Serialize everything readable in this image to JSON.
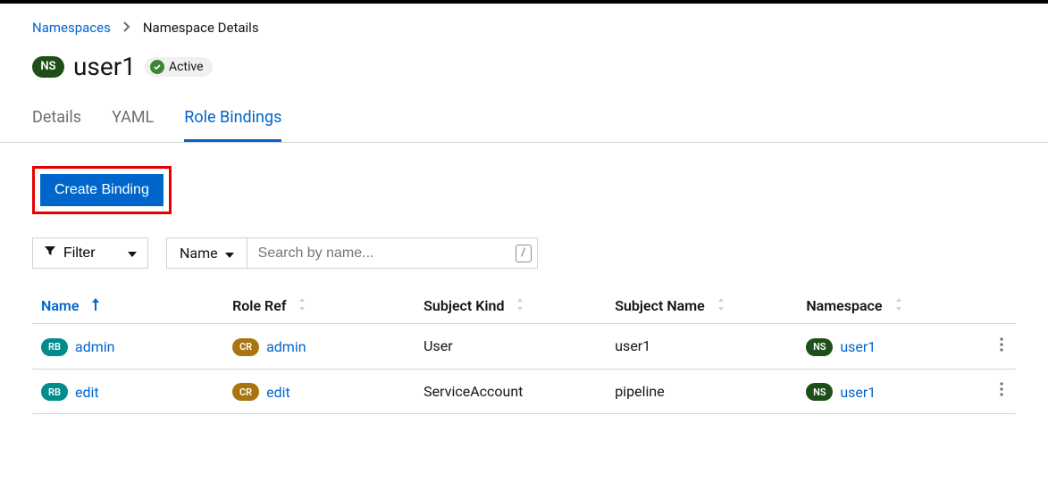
{
  "breadcrumb": {
    "root": "Namespaces",
    "current": "Namespace Details"
  },
  "header": {
    "resource_badge": "NS",
    "title": "user1",
    "status": "Active"
  },
  "tabs": [
    {
      "label": "Details",
      "active": false
    },
    {
      "label": "YAML",
      "active": false
    },
    {
      "label": "Role Bindings",
      "active": true
    }
  ],
  "actions": {
    "create_binding": "Create Binding"
  },
  "toolbar": {
    "filter_label": "Filter",
    "search_type": "Name",
    "search_placeholder": "Search by name...",
    "shortcut_key": "/"
  },
  "columns": {
    "name": "Name",
    "role_ref": "Role Ref",
    "subject_kind": "Subject Kind",
    "subject_name": "Subject Name",
    "namespace": "Namespace"
  },
  "rows": [
    {
      "name_badge": "RB",
      "name": "admin",
      "roleref_badge": "CR",
      "roleref": "admin",
      "subject_kind": "User",
      "subject_name": "user1",
      "ns_badge": "NS",
      "namespace": "user1"
    },
    {
      "name_badge": "RB",
      "name": "edit",
      "roleref_badge": "CR",
      "roleref": "edit",
      "subject_kind": "ServiceAccount",
      "subject_name": "pipeline",
      "ns_badge": "NS",
      "namespace": "user1"
    }
  ]
}
